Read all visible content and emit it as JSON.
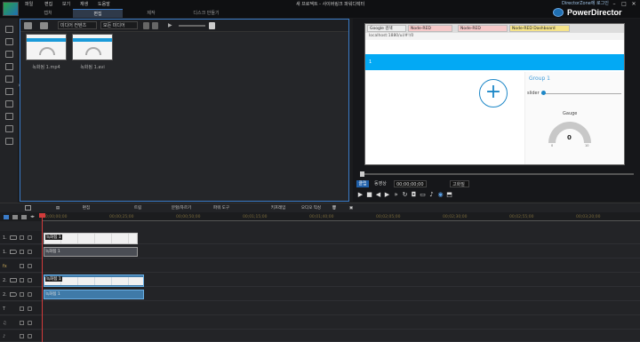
{
  "app": {
    "title": "새 프로젝트 - 사이버링크 파워디렉터",
    "brand": "PowerDirector",
    "top_right": "DirectorZone에 로그인",
    "menu": [
      "파일",
      "편집",
      "보기",
      "재생",
      "도움말"
    ],
    "mode_tabs": [
      "캡처",
      "편집",
      "제작",
      "디스크 만들기"
    ],
    "active_mode": "편집",
    "window_buttons": [
      "–",
      "□",
      "✕"
    ]
  },
  "library": {
    "dropdown_type": "미디어 컨텐츠",
    "dropdown_filter": "모든 미디어",
    "items": [
      {
        "name": "녹화됨 1.mp4"
      },
      {
        "name": "녹화됨 1.avi"
      }
    ]
  },
  "preview": {
    "browser_tabs": [
      "Google 검색",
      "Node-RED",
      "Node-RED",
      "Node-RED Dashboard"
    ],
    "address": "localhost:1880/ui/#!/0",
    "page_header": "1",
    "group_title": "Group 1",
    "slider_label": "slider",
    "slider_value": 0.02,
    "gauge_label": "Gauge",
    "gauge_value": "0",
    "gauge_min": "0",
    "gauge_max": "10",
    "clip_label": "클립",
    "movie_label": "동영상",
    "timecode": "00;00;00;00",
    "quality": "고화질",
    "position": 0.0
  },
  "mid_toolbar": [
    "편집",
    "트림",
    "분할/자르기",
    "파워 도구",
    "키프레임",
    "오디오 믹싱"
  ],
  "timeline": {
    "ruler_ticks": [
      "00;00;00;00",
      "00;00;25;00",
      "00;00;50;00",
      "00;01;15;00",
      "00;01;40;00",
      "00;02;05;00",
      "00;02;30;00",
      "00;02;55;00",
      "00;03;20;00"
    ],
    "tracks": [
      {
        "num": "1.",
        "kind": "video"
      },
      {
        "num": "1.",
        "kind": "audio"
      },
      {
        "num": "",
        "kind": "fx"
      },
      {
        "num": "2.",
        "kind": "video"
      },
      {
        "num": "2.",
        "kind": "audio"
      },
      {
        "num": "",
        "kind": "title"
      },
      {
        "num": "",
        "kind": "voice"
      },
      {
        "num": "",
        "kind": "music"
      }
    ],
    "clips": [
      {
        "label": "녹화됨 1"
      },
      {
        "label": "녹화됨 1"
      },
      {
        "label": "녹화됨 1"
      },
      {
        "label": "녹화됨 1"
      }
    ]
  },
  "colors": {
    "accent": "#3a7bc8",
    "node_red_header": "#03a9f4",
    "playhead": "#d23b3b"
  }
}
